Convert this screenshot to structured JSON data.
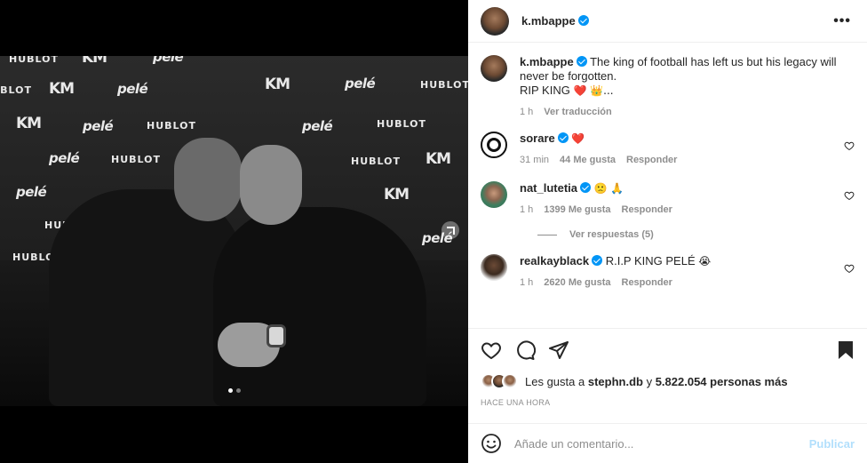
{
  "post": {
    "author": "k.mbappe",
    "caption_text": "The king of football has left us but his legacy will never be forgotten.",
    "caption_line2": "RIP KING",
    "caption_emoji": "❤️ 👑...",
    "time": "1 h",
    "translate_label": "Ver traducción",
    "image_sponsors": {
      "hublot": "HUBLOT",
      "km": "KM",
      "pele": "pelé"
    }
  },
  "comments": [
    {
      "user": "sorare",
      "text": "",
      "emoji": "❤️",
      "time": "31 min",
      "likes": "44 Me gusta",
      "reply": "Responder"
    },
    {
      "user": "nat_lutetia",
      "text": "",
      "emoji": "🙁 🙏",
      "time": "1 h",
      "likes": "1399 Me gusta",
      "reply": "Responder",
      "view_replies": "Ver respuestas (5)"
    },
    {
      "user": "realkayblack",
      "text": "R.I.P KING PELÉ",
      "emoji": "😭",
      "time": "1 h",
      "likes": "2620 Me gusta",
      "reply": "Responder"
    }
  ],
  "likes_summary": {
    "prefix": "Les gusta a",
    "first_user": "stephn.db",
    "conjunction": "y",
    "others": "5.822.054 personas más"
  },
  "timeago": "HACE UNA HORA",
  "comment_input": {
    "placeholder": "Añade un comentario...",
    "publish_label": "Publicar"
  },
  "colors": {
    "verified": "#0095f6",
    "heart": "#ed4956",
    "publish_disabled": "#b2dffc",
    "secondary_text": "#8e8e8e"
  }
}
